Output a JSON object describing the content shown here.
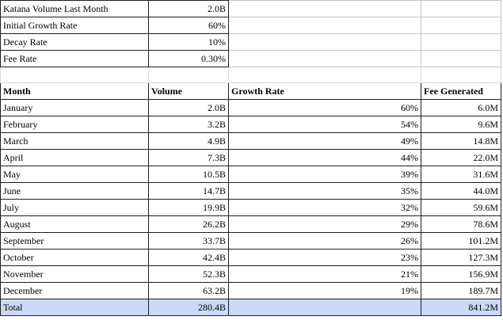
{
  "params": [
    {
      "label": "Katana Volume Last Month",
      "value": "2.0B"
    },
    {
      "label": "Initial Growth Rate",
      "value": "60%"
    },
    {
      "label": "Decay Rate",
      "value": "10%"
    },
    {
      "label": "Fee Rate",
      "value": "0.30%"
    }
  ],
  "headers": {
    "month": "Month",
    "volume": "Volume",
    "growth": "Growth Rate",
    "fee": "Fee Generated"
  },
  "rows": [
    {
      "month": "January",
      "volume": "2.0B",
      "growth": "60%",
      "fee": "6.0M"
    },
    {
      "month": "February",
      "volume": "3.2B",
      "growth": "54%",
      "fee": "9.6M"
    },
    {
      "month": "March",
      "volume": "4.9B",
      "growth": "49%",
      "fee": "14.8M"
    },
    {
      "month": "April",
      "volume": "7.3B",
      "growth": "44%",
      "fee": "22.0M"
    },
    {
      "month": "May",
      "volume": "10.5B",
      "growth": "39%",
      "fee": "31.6M"
    },
    {
      "month": "June",
      "volume": "14.7B",
      "growth": "35%",
      "fee": "44.0M"
    },
    {
      "month": "July",
      "volume": "19.9B",
      "growth": "32%",
      "fee": "59.6M"
    },
    {
      "month": "August",
      "volume": "26.2B",
      "growth": "29%",
      "fee": "78.6M"
    },
    {
      "month": "September",
      "volume": "33.7B",
      "growth": "26%",
      "fee": "101.2M"
    },
    {
      "month": "October",
      "volume": "42.4B",
      "growth": "23%",
      "fee": "127.3M"
    },
    {
      "month": "November",
      "volume": "52.3B",
      "growth": "21%",
      "fee": "156.9M"
    },
    {
      "month": "December",
      "volume": "63.2B",
      "growth": "19%",
      "fee": "189.7M"
    }
  ],
  "total": {
    "label": "Total",
    "volume": "280.4B",
    "growth": "",
    "fee": "841.2M"
  }
}
